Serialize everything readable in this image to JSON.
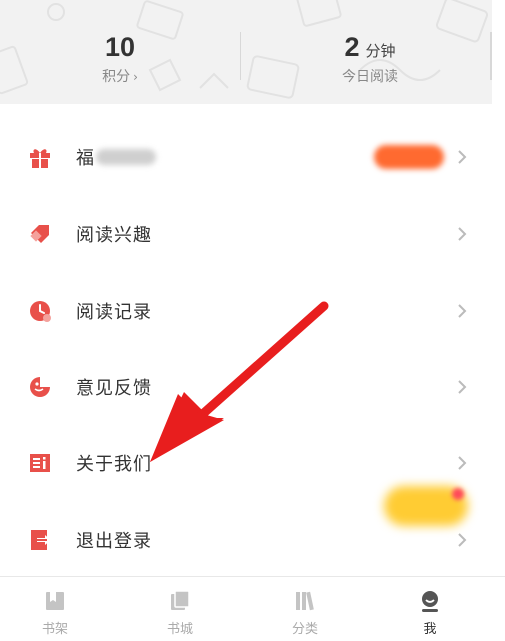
{
  "stats": {
    "points": {
      "value": "10",
      "label": "积分",
      "chevron": "›"
    },
    "reading": {
      "value": "2",
      "unit": "分钟",
      "label": "今日阅读"
    }
  },
  "menu": {
    "items": [
      {
        "label": "福",
        "icon": "gift-icon"
      },
      {
        "label": "阅读兴趣",
        "icon": "tag-icon"
      },
      {
        "label": "阅读记录",
        "icon": "clock-icon"
      },
      {
        "label": "意见反馈",
        "icon": "feedback-icon"
      },
      {
        "label": "关于我们",
        "icon": "info-icon"
      },
      {
        "label": "退出登录",
        "icon": "logout-icon"
      }
    ]
  },
  "tabbar": {
    "tabs": [
      {
        "label": "书架",
        "icon": "bookshelf-icon",
        "active": false
      },
      {
        "label": "书城",
        "icon": "bookstore-icon",
        "active": false
      },
      {
        "label": "分类",
        "icon": "category-icon",
        "active": false
      },
      {
        "label": "我",
        "icon": "profile-icon",
        "active": true
      }
    ]
  },
  "colors": {
    "accent": "#e8504a",
    "arrow": "#e81e1e",
    "header_bg": "#f2f2f2",
    "badge": "#ff6a30"
  }
}
